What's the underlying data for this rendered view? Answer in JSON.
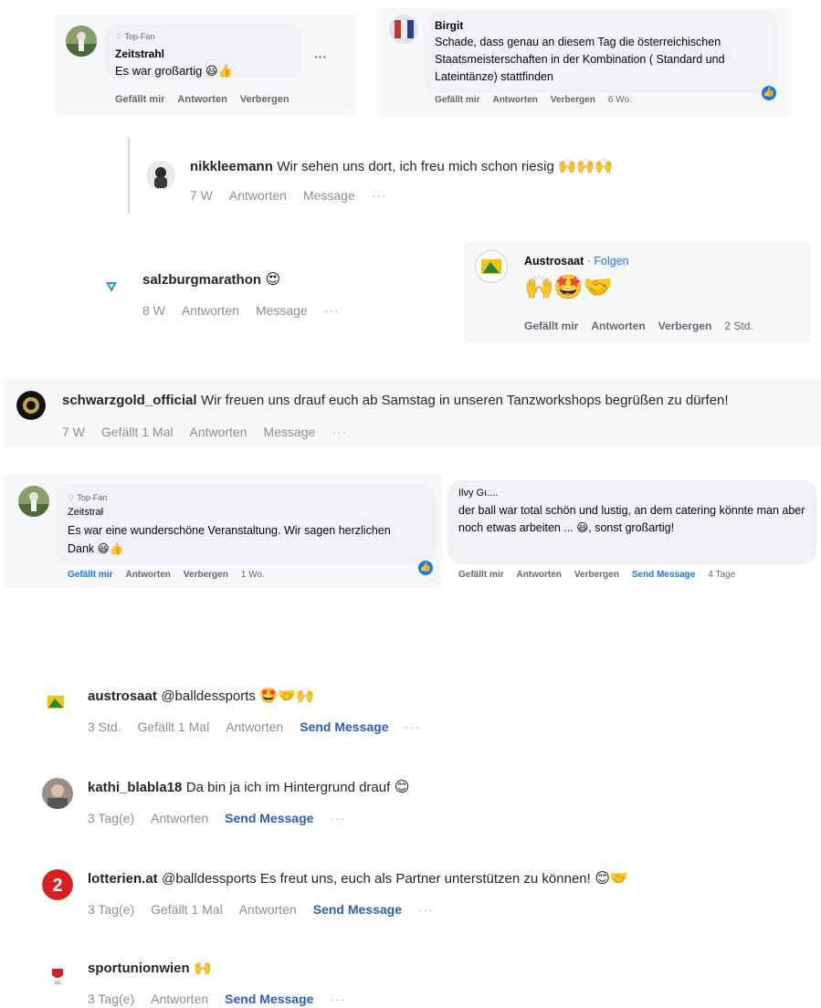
{
  "fb_zeitstrahl_1": {
    "badge": "Top-Fan",
    "name": "Zeitstrahl",
    "text": "Es war großartig",
    "emoji": "😃👍",
    "more": "···",
    "actions": [
      "Gefällt mir",
      "Antworten",
      "Verbergen"
    ]
  },
  "fb_birgit": {
    "name": "Birgit",
    "text": "Schade, dass genau an diesem Tag die österreichischen Staatsmeisterschaften in der Kombination ( Standard und Lateintänze) stattfinden",
    "actions": [
      "Gefällt mir",
      "Antworten",
      "Verbergen"
    ],
    "time": "6 Wo."
  },
  "ig_nikkleemann": {
    "user": "nikkleemann",
    "text": "Wir sehen uns dort, ich freu mich schon riesig",
    "emoji": "🙌🙌🙌",
    "time": "7 W",
    "reply": "Antworten",
    "message": "Message",
    "more": "···"
  },
  "ig_salzburgmarathon": {
    "user": "salzburgmarathon",
    "emoji": "😍",
    "time": "8 W",
    "reply": "Antworten",
    "message": "Message",
    "more": "···"
  },
  "fb_austrosaat": {
    "name": "Austrosaat",
    "follow": "· Folgen",
    "emoji": "🙌🤩🤝",
    "actions": [
      "Gefällt mir",
      "Antworten",
      "Verbergen"
    ],
    "time": "2 Std."
  },
  "ig_schwarzgold": {
    "user": "schwarzgold_official",
    "text": "Wir freuen uns drauf euch ab Samstag in unseren Tanzworkshops begrüßen zu dürfen!",
    "time": "7 W",
    "likes": "Gefällt 1 Mal",
    "reply": "Antworten",
    "message": "Message",
    "more": "···"
  },
  "fb_zeitstrahl_2": {
    "badge": "Top-Fan",
    "name": "Zeitstrał",
    "text": "Es war eine wunderschöne Veranstaltung. Wir sagen herzlichen Dank",
    "emoji": "😃👍",
    "actions": [
      "Gefällt mir",
      "Antworten",
      "Verbergen"
    ],
    "time": "1 Wo."
  },
  "fb_ilvy": {
    "name": "Ilvy Gı....",
    "text": "der ball war total schön und lustig, an dem catering könnte man aber noch etwas arbeiten ... 😃, sonst großartig!",
    "actions": [
      "Gefällt mir",
      "Antworten",
      "Verbergen",
      "Send Message"
    ],
    "time": "4 Tage"
  },
  "ig_austrosaat": {
    "user": "austrosaat",
    "text": "@balldessports",
    "emoji": "🤩🤝🙌",
    "time": "3 Std.",
    "likes": "Gefällt 1 Mal",
    "reply": "Antworten",
    "message": "Send Message",
    "more": "···"
  },
  "ig_kathi": {
    "user": "kathi_blabla18",
    "text": "Da bin ja ich im Hintergrund drauf",
    "emoji": "😊",
    "time": "3 Tag(e)",
    "reply": "Antworten",
    "message": "Send Message",
    "more": "···"
  },
  "ig_lotterien": {
    "user": "lotterien.at",
    "text": "@balldessports Es freut uns, euch als Partner unterstützen zu können!",
    "emoji": "😊🤝",
    "time": "3 Tag(e)",
    "likes": "Gefällt 1 Mal",
    "reply": "Antworten",
    "message": "Send Message",
    "more": "···"
  },
  "ig_sportunion": {
    "user": "sportunionwien",
    "emoji": "🙌",
    "time": "3 Tag(e)",
    "reply": "Antworten",
    "message": "Send Message",
    "more": "···"
  },
  "colors": {
    "fb_blue": "#1877f2",
    "ig_link": "#2b5fbf",
    "bubble": "#f0f2f5",
    "muted": "#65676b"
  }
}
